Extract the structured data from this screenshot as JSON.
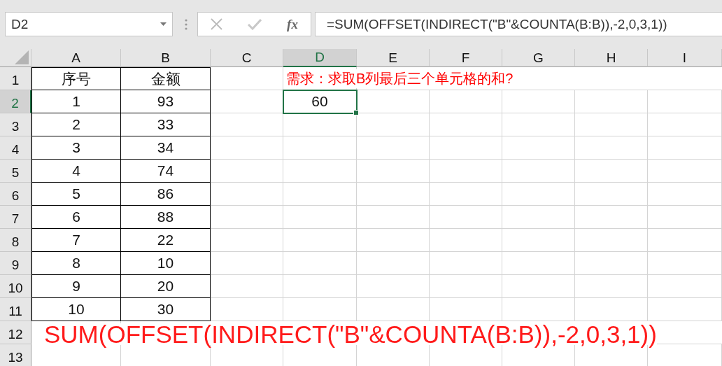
{
  "name_box": {
    "value": "D2"
  },
  "formula_bar": {
    "function_label": "fx",
    "formula": "=SUM(OFFSET(INDIRECT(\"B\"&COUNTA(B:B)),-2,0,3,1))"
  },
  "columns": [
    {
      "label": "A",
      "selected": false
    },
    {
      "label": "B",
      "selected": false
    },
    {
      "label": "C",
      "selected": false
    },
    {
      "label": "D",
      "selected": true
    },
    {
      "label": "E",
      "selected": false
    },
    {
      "label": "F",
      "selected": false
    },
    {
      "label": "G",
      "selected": false
    },
    {
      "label": "H",
      "selected": false
    },
    {
      "label": "I",
      "selected": false
    }
  ],
  "rows": [
    {
      "header": "1",
      "selected": false,
      "cells": [
        {
          "text": "序号",
          "kind": "table"
        },
        {
          "text": "金额",
          "kind": "table"
        },
        null,
        {
          "text": "需求：求取B列最后三个单元格的和?",
          "kind": "note"
        }
      ]
    },
    {
      "header": "2",
      "selected": true,
      "cells": [
        {
          "text": "1",
          "kind": "table"
        },
        {
          "text": "93",
          "kind": "table"
        },
        null,
        {
          "text": "60",
          "kind": "value"
        }
      ]
    },
    {
      "header": "3",
      "selected": false,
      "cells": [
        {
          "text": "2",
          "kind": "table"
        },
        {
          "text": "33",
          "kind": "table"
        }
      ]
    },
    {
      "header": "4",
      "selected": false,
      "cells": [
        {
          "text": "3",
          "kind": "table"
        },
        {
          "text": "34",
          "kind": "table"
        }
      ]
    },
    {
      "header": "5",
      "selected": false,
      "cells": [
        {
          "text": "4",
          "kind": "table"
        },
        {
          "text": "74",
          "kind": "table"
        }
      ]
    },
    {
      "header": "6",
      "selected": false,
      "cells": [
        {
          "text": "5",
          "kind": "table"
        },
        {
          "text": "86",
          "kind": "table"
        }
      ]
    },
    {
      "header": "7",
      "selected": false,
      "cells": [
        {
          "text": "6",
          "kind": "table"
        },
        {
          "text": "88",
          "kind": "table"
        }
      ]
    },
    {
      "header": "8",
      "selected": false,
      "cells": [
        {
          "text": "7",
          "kind": "table"
        },
        {
          "text": "22",
          "kind": "table"
        }
      ]
    },
    {
      "header": "9",
      "selected": false,
      "cells": [
        {
          "text": "8",
          "kind": "table"
        },
        {
          "text": "10",
          "kind": "table"
        }
      ]
    },
    {
      "header": "10",
      "selected": false,
      "cells": [
        {
          "text": "9",
          "kind": "table"
        },
        {
          "text": "20",
          "kind": "table"
        }
      ]
    },
    {
      "header": "11",
      "selected": false,
      "cells": [
        {
          "text": "10",
          "kind": "table"
        },
        {
          "text": "30",
          "kind": "table"
        }
      ]
    },
    {
      "header": "12",
      "selected": false,
      "cells": [
        {
          "text": "SUM(OFFSET(INDIRECT(\"B\"&COUNTA(B:B)),-2,0,3,1))",
          "kind": "banner"
        }
      ]
    },
    {
      "header": "13",
      "selected": false
    }
  ]
}
